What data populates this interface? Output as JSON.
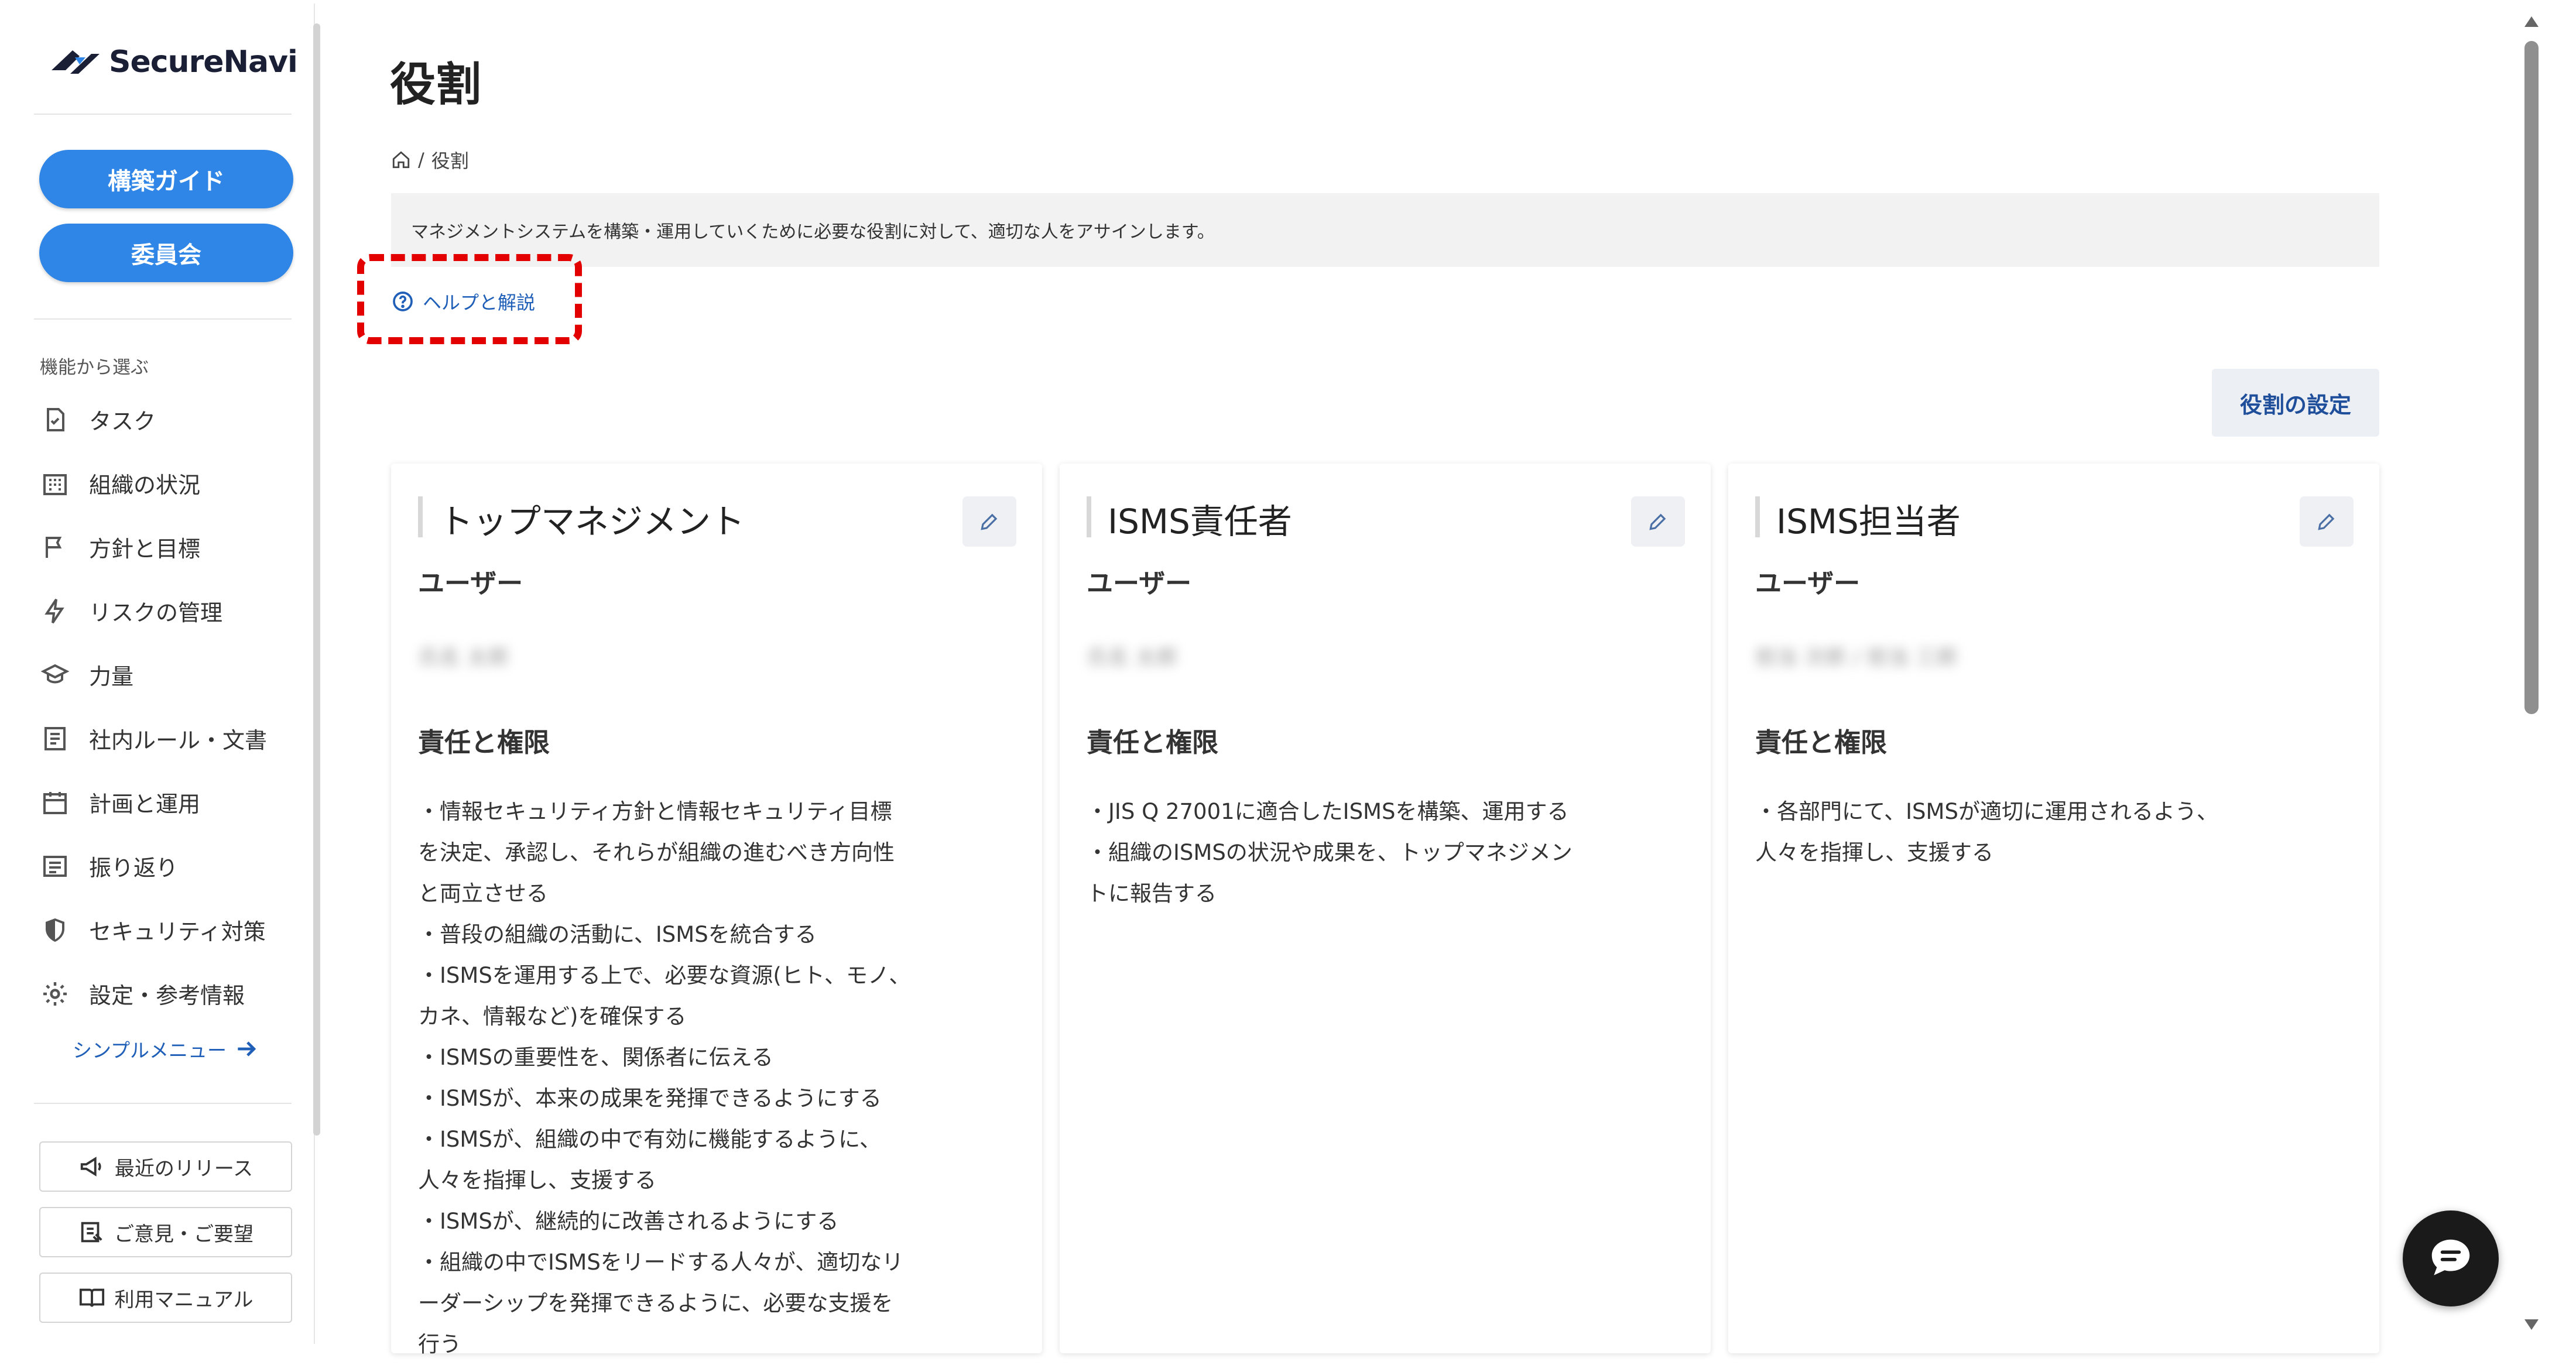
{
  "app": {
    "logo_text": "SecureNavi"
  },
  "sidebar": {
    "pill_buttons": [
      {
        "label": "構築ガイド"
      },
      {
        "label": "委員会"
      }
    ],
    "section_label": "機能から選ぶ",
    "items": [
      {
        "label": "タスク",
        "icon": "task-check-icon"
      },
      {
        "label": "組織の状況",
        "icon": "building-icon"
      },
      {
        "label": "方針と目標",
        "icon": "flag-icon"
      },
      {
        "label": "リスクの管理",
        "icon": "lightning-icon"
      },
      {
        "label": "力量",
        "icon": "graduation-cap-icon"
      },
      {
        "label": "社内ルール・文書",
        "icon": "document-icon"
      },
      {
        "label": "計画と運用",
        "icon": "calendar-icon"
      },
      {
        "label": "振り返り",
        "icon": "review-list-icon"
      },
      {
        "label": "セキュリティ対策",
        "icon": "shield-icon"
      },
      {
        "label": "設定・参考情報",
        "icon": "gear-icon"
      }
    ],
    "simple_menu": "シンプルメニュー",
    "bottom_buttons": [
      {
        "label": "最近のリリース",
        "icon": "megaphone-icon"
      },
      {
        "label": "ご意見・ご要望",
        "icon": "feedback-icon"
      },
      {
        "label": "利用マニュアル",
        "icon": "book-icon"
      }
    ]
  },
  "main": {
    "title": "役割",
    "breadcrumb": {
      "separator": "/",
      "current": "役割"
    },
    "description": "マネジメントシステムを構築・運用していくために必要な役割に対して、適切な人をアサインします。",
    "help_link": "ヘルプと解説",
    "role_settings_button": "役割の設定",
    "user_heading": "ユーザー",
    "responsibility_heading": "責任と権限",
    "cards": [
      {
        "title": "トップマネジメント",
        "user_blurred": "氏名 太郎",
        "responsibilities": [
          "・情報セキュリティ方針と情報セキュリティ目標",
          "を決定、承認し、それらが組織の進むべき方向性",
          "と両立させる",
          "・普段の組織の活動に、ISMSを統合する",
          "・ISMSを運用する上で、必要な資源(ヒト、モノ、",
          "カネ、情報など)を確保する",
          "・ISMSの重要性を、関係者に伝える",
          "・ISMSが、本来の成果を発揮できるようにする",
          "・ISMSが、組織の中で有効に機能するように、",
          "人々を指揮し、支援する",
          "・ISMSが、継続的に改善されるようにする",
          "・組織の中でISMSをリードする人々が、適切なリ",
          "ーダーシップを発揮できるように、必要な支援を",
          "行う"
        ]
      },
      {
        "title": "ISMS責任者",
        "user_blurred": "氏名 太郎",
        "responsibilities": [
          "・JIS Q 27001に適合したISMSを構築、運用する",
          "・組織のISMSの状況や成果を、トップマネジメン",
          "トに報告する"
        ]
      },
      {
        "title": "ISMS担当者",
        "user_blurred": "担当 次郎 / 担当 三郎",
        "responsibilities": [
          "・各部門にて、ISMSが適切に運用されるよう、",
          "人々を指揮し、支援する"
        ]
      }
    ]
  },
  "colors": {
    "accent": "#2f86e6",
    "link": "#1f5fb8",
    "highlight": "#e30000"
  }
}
